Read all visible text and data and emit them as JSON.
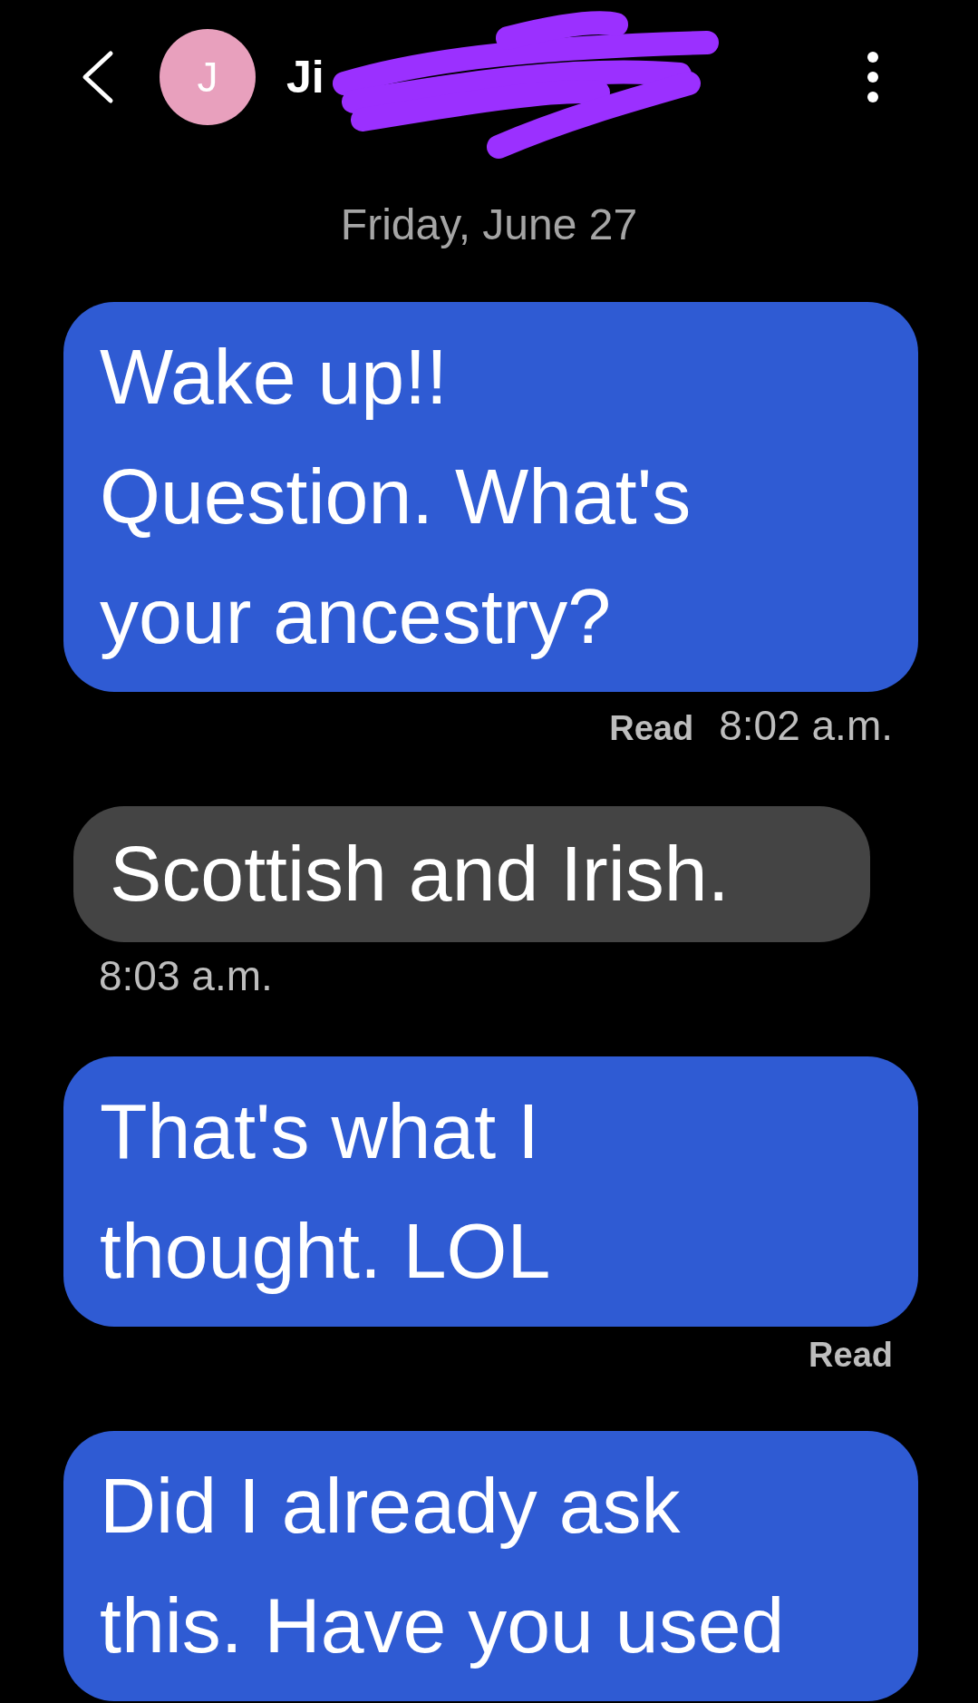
{
  "header": {
    "avatar_letter": "J",
    "name": "Ji"
  },
  "date": "Friday, June 27",
  "messages": [
    {
      "kind": "sent",
      "text": "Wake up!!\nQuestion. What's\nyour ancestry?",
      "status": "Read",
      "time": "8:02 a.m."
    },
    {
      "kind": "received",
      "text": "Scottish and Irish.",
      "time": "8:03 a.m."
    },
    {
      "kind": "sent",
      "text": "That's what I\nthought. LOL",
      "status": "Read"
    },
    {
      "kind": "sent",
      "text": "Did I already ask\nthis. Have you used"
    }
  ]
}
